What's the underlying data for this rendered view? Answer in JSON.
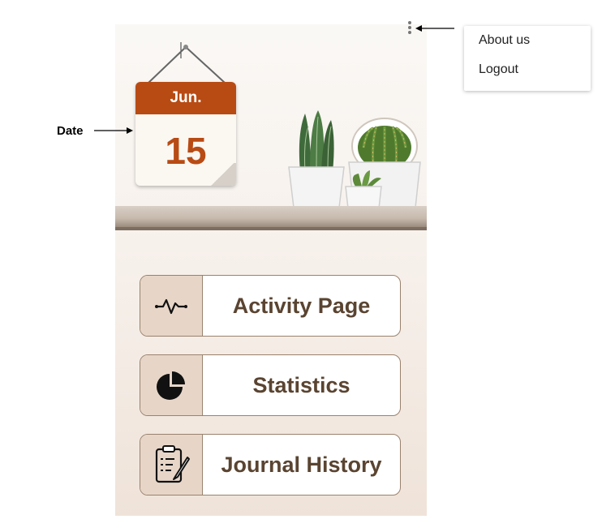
{
  "calendar": {
    "month": "Jun.",
    "day": "15"
  },
  "buttons": [
    {
      "label": "Activity Page",
      "icon": "activity-icon"
    },
    {
      "label": "Statistics",
      "icon": "pie-chart-icon"
    },
    {
      "label": "Journal History",
      "icon": "journal-icon"
    }
  ],
  "overflow_menu": {
    "icon": "more-vert-icon",
    "items": [
      "About us",
      "Logout"
    ]
  },
  "annotations": {
    "date_label": "Date"
  },
  "colors": {
    "calendar_header": "#b84b14",
    "button_text": "#5a4431",
    "icon_box": "#e7d6c8",
    "border": "#9a826d"
  }
}
